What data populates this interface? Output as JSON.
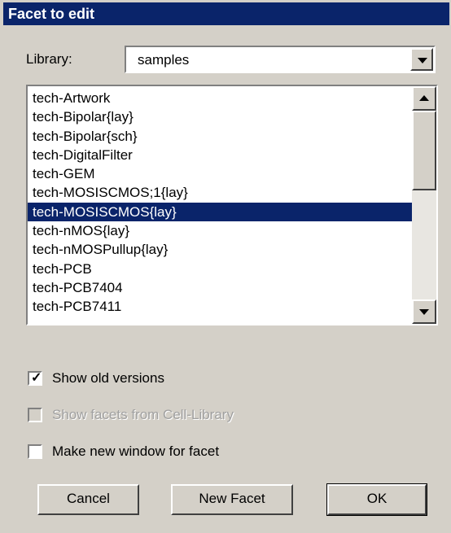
{
  "window": {
    "title": "Facet to edit"
  },
  "library": {
    "label": "Library:",
    "selected": "samples"
  },
  "facets": {
    "items": [
      "tech-Artwork",
      "tech-Bipolar{lay}",
      "tech-Bipolar{sch}",
      "tech-DigitalFilter",
      "tech-GEM",
      "tech-MOSISCMOS;1{lay}",
      "tech-MOSISCMOS{lay}",
      "tech-nMOS{lay}",
      "tech-nMOSPullup{lay}",
      "tech-PCB",
      "tech-PCB7404",
      "tech-PCB7411"
    ],
    "selected_index": 6
  },
  "options": {
    "show_old_versions": {
      "label": "Show old versions",
      "checked": true,
      "enabled": true
    },
    "show_cell_library": {
      "label": "Show facets from Cell-Library",
      "checked": false,
      "enabled": false
    },
    "new_window": {
      "label": "Make new window for facet",
      "checked": false,
      "enabled": true
    }
  },
  "buttons": {
    "cancel": "Cancel",
    "new_facet": "New Facet",
    "ok": "OK"
  },
  "colors": {
    "selection": "#0a246a",
    "dialog_bg": "#d4d0c8"
  }
}
